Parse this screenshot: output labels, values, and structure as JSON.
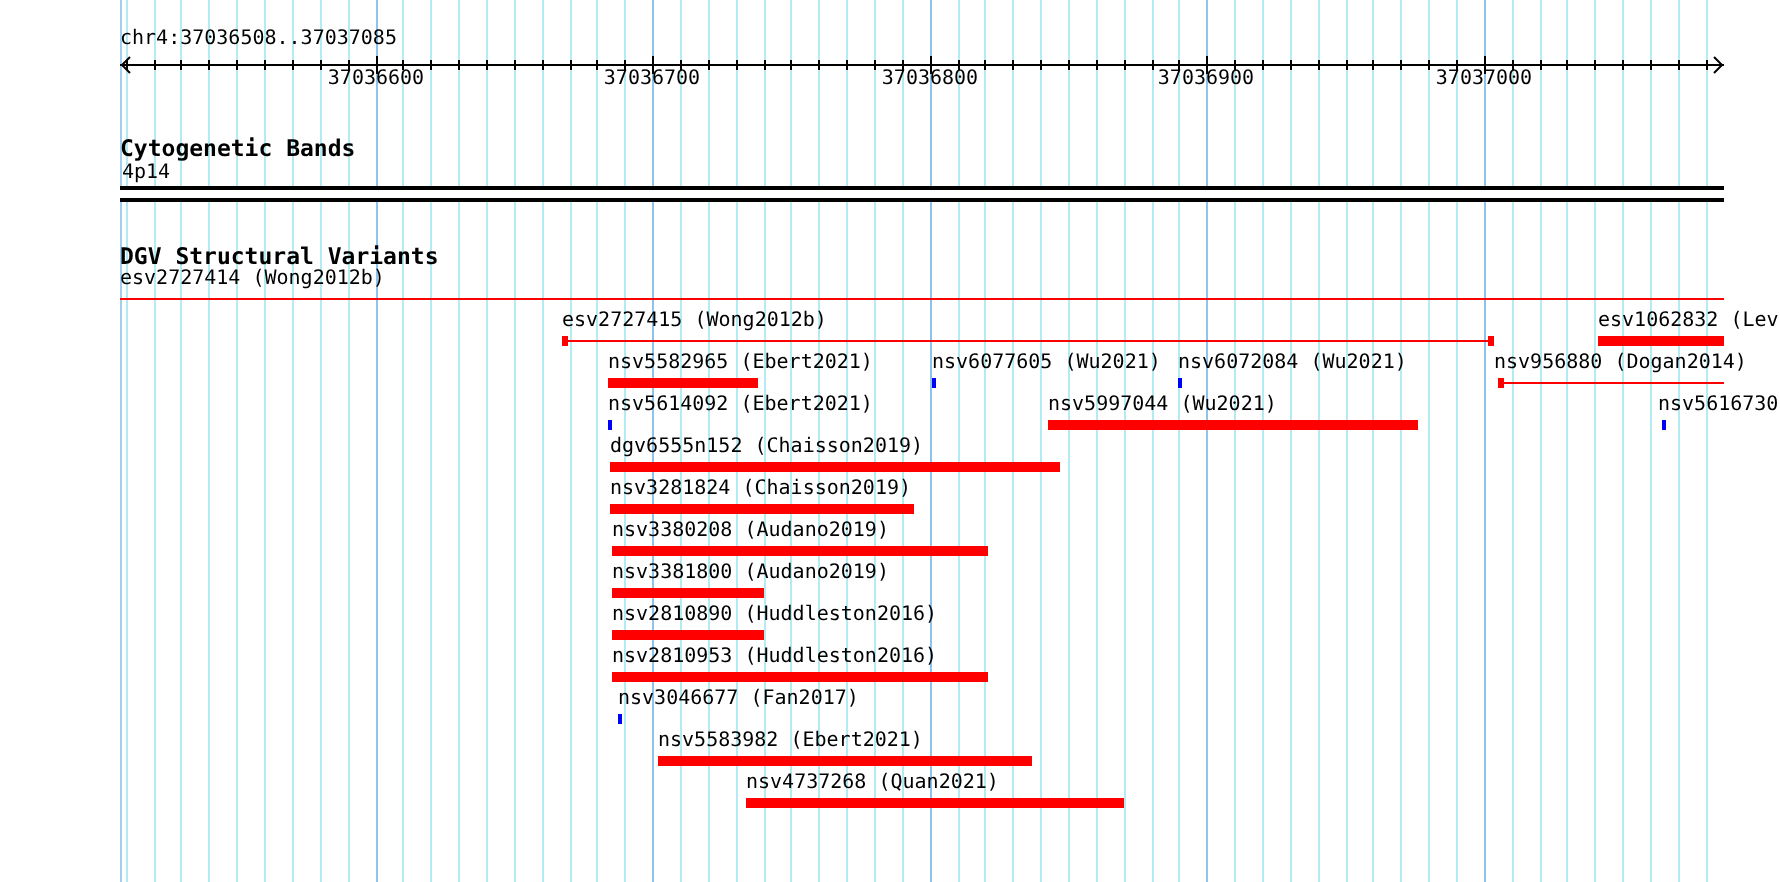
{
  "ruler": {
    "label": "chr4:37036508..37037085",
    "tick_labels": [
      "37036600",
      "37036700",
      "37036800",
      "37036900",
      "37037000"
    ]
  },
  "tracks": [
    {
      "title": "Cytogenetic Bands",
      "features": [
        {
          "label": "4p14",
          "kind": "band"
        }
      ]
    },
    {
      "title": "DGV Structural Variants",
      "features": [
        {
          "label": "esv2727414 (Wong2012b)",
          "kind": "line"
        },
        {
          "label": "esv2727415 (Wong2012b)",
          "kind": "line"
        },
        {
          "label": "esv1062832 (Lev",
          "kind": "bar"
        },
        {
          "label": "nsv5582965 (Ebert2021)",
          "kind": "bar"
        },
        {
          "label": "nsv6077605 (Wu2021)",
          "kind": "tick"
        },
        {
          "label": "nsv6072084 (Wu2021)",
          "kind": "tick"
        },
        {
          "label": "nsv956880 (Dogan2014)",
          "kind": "line"
        },
        {
          "label": "nsv5614092 (Ebert2021)",
          "kind": "tick"
        },
        {
          "label": "nsv5997044 (Wu2021)",
          "kind": "bar"
        },
        {
          "label": "nsv5616730",
          "kind": "tick"
        },
        {
          "label": "dgv6555n152 (Chaisson2019)",
          "kind": "bar"
        },
        {
          "label": "nsv3281824 (Chaisson2019)",
          "kind": "bar"
        },
        {
          "label": "nsv3380208 (Audano2019)",
          "kind": "bar"
        },
        {
          "label": "nsv3381800 (Audano2019)",
          "kind": "bar"
        },
        {
          "label": "nsv2810890 (Huddleston2016)",
          "kind": "bar"
        },
        {
          "label": "nsv2810953 (Huddleston2016)",
          "kind": "bar"
        },
        {
          "label": "nsv3046677 (Fan2017)",
          "kind": "tick"
        },
        {
          "label": "nsv5583982 (Ebert2021)",
          "kind": "bar"
        },
        {
          "label": "nsv4737268 (Quan2021)",
          "kind": "bar"
        }
      ]
    }
  ]
}
